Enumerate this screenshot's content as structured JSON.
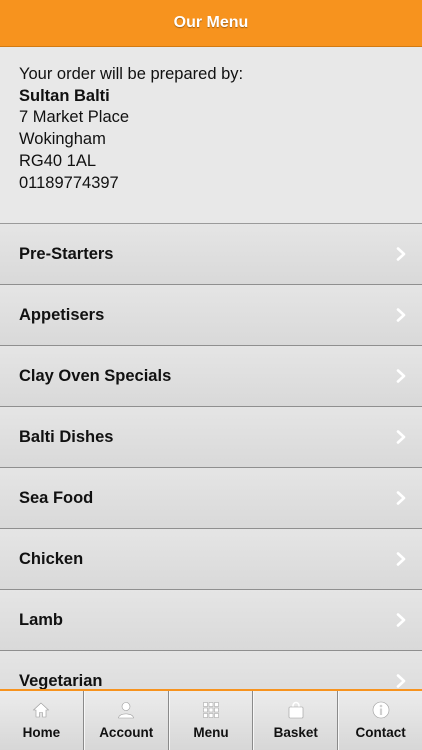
{
  "header": {
    "title": "Our Menu"
  },
  "restaurant": {
    "prepared_by": "Your order will be prepared by:",
    "name": "Sultan Balti",
    "address1": "7 Market Place",
    "town": "Wokingham",
    "postcode": "RG40 1AL",
    "phone": "01189774397"
  },
  "menu": {
    "items": [
      {
        "label": "Pre-Starters"
      },
      {
        "label": "Appetisers"
      },
      {
        "label": "Clay Oven Specials"
      },
      {
        "label": "Balti Dishes"
      },
      {
        "label": "Sea Food"
      },
      {
        "label": "Chicken"
      },
      {
        "label": "Lamb"
      },
      {
        "label": "Vegetarian"
      }
    ]
  },
  "tabbar": {
    "tabs": [
      {
        "label": "Home",
        "icon": "home-icon"
      },
      {
        "label": "Account",
        "icon": "user-icon"
      },
      {
        "label": "Menu",
        "icon": "grid-icon"
      },
      {
        "label": "Basket",
        "icon": "bag-icon"
      },
      {
        "label": "Contact",
        "icon": "info-icon"
      }
    ]
  },
  "colors": {
    "accent": "#f7931e",
    "background": "#e6e6e6"
  }
}
